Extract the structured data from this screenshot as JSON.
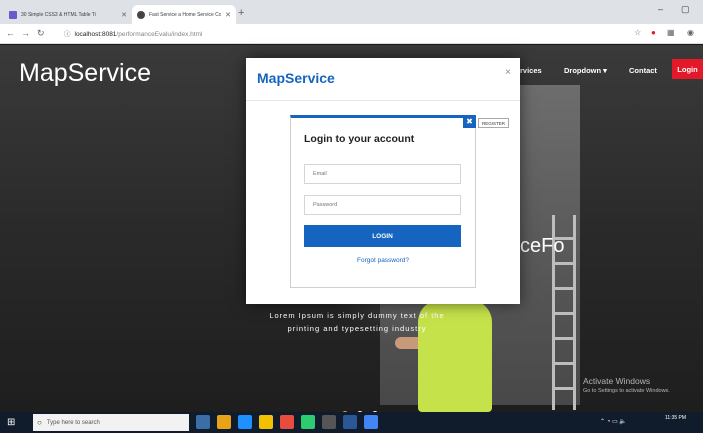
{
  "browser": {
    "tabs": [
      {
        "title": "30 Simple CSS3 & HTML Table Ti",
        "favicon_color": "#6a5acd"
      },
      {
        "title": "Fast Service a Home Service Con",
        "favicon_color": "#444444"
      }
    ],
    "new_tab_icon": "+",
    "url_host": "localhost:8081",
    "url_path": "/performanceEvalu/index.html",
    "window_controls": [
      "–",
      "▢"
    ]
  },
  "site": {
    "brand": "MapService",
    "nav": [
      {
        "label": "rvices"
      },
      {
        "label": "Dropdown ▾"
      },
      {
        "label": "Contact"
      }
    ],
    "login_label": "Login",
    "hero_fragment": "ceFo",
    "hero_subtitle": "Lorem Ipsum is simply dummy text of the printing and typesetting industry"
  },
  "modal": {
    "title": "MapService",
    "close_icon": "×",
    "card_close_icon": "✖",
    "register_tab": "REGISTER",
    "card_title": "Login to your account",
    "email_placeholder": "Email",
    "password_placeholder": "Password",
    "login_button": "LOGIN",
    "forgot_password": "Forgot password?"
  },
  "carousel": {
    "active_index": 0,
    "count": 3
  },
  "windows_activation": {
    "line1": "Activate Windows",
    "line2": "Go to Settings to activate Windows."
  },
  "taskbar": {
    "search_placeholder": "Type here to search",
    "time": "11:35 PM",
    "app_colors": [
      "#3a6ea5",
      "#e8a317",
      "#1e90ff",
      "#f2c200",
      "#e74c3c",
      "#2ecc71",
      "#555555",
      "#2b5797",
      "#4285f4"
    ]
  },
  "colors": {
    "accent": "#1565c0",
    "login_red": "#e3192a",
    "active_dot": "#f5a623"
  }
}
